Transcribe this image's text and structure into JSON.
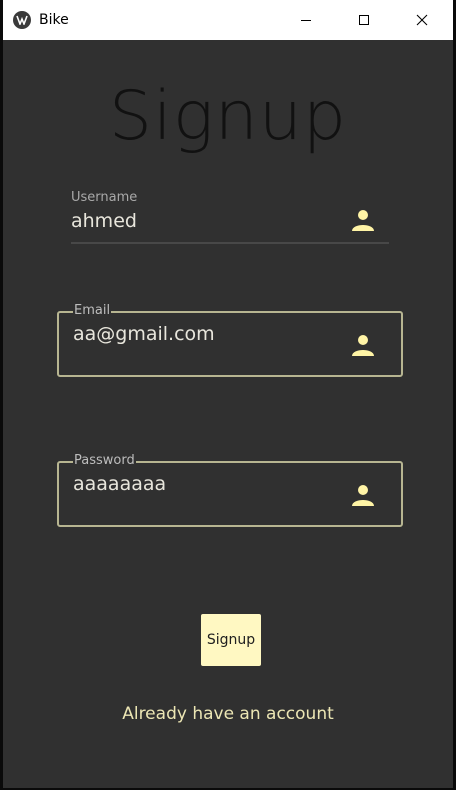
{
  "window": {
    "title": "Bike",
    "controls": [
      "minimize-icon",
      "maximize-icon",
      "close-icon"
    ]
  },
  "page": {
    "heading": "Signup"
  },
  "form": {
    "username": {
      "label": "Username",
      "value": "ahmed",
      "icon": "person-icon"
    },
    "email": {
      "label": "Email",
      "value": "aa@gmail.com",
      "icon": "person-icon"
    },
    "password": {
      "label": "Password",
      "value": "aaaaaaaa",
      "icon": "person-icon"
    }
  },
  "actions": {
    "signup_label": "Signup",
    "login_link_label": "Already have an account"
  },
  "colors": {
    "background": "#303030",
    "accent": "#fff8c2",
    "icon": "#fff4a6",
    "outline": "#b7b591"
  }
}
